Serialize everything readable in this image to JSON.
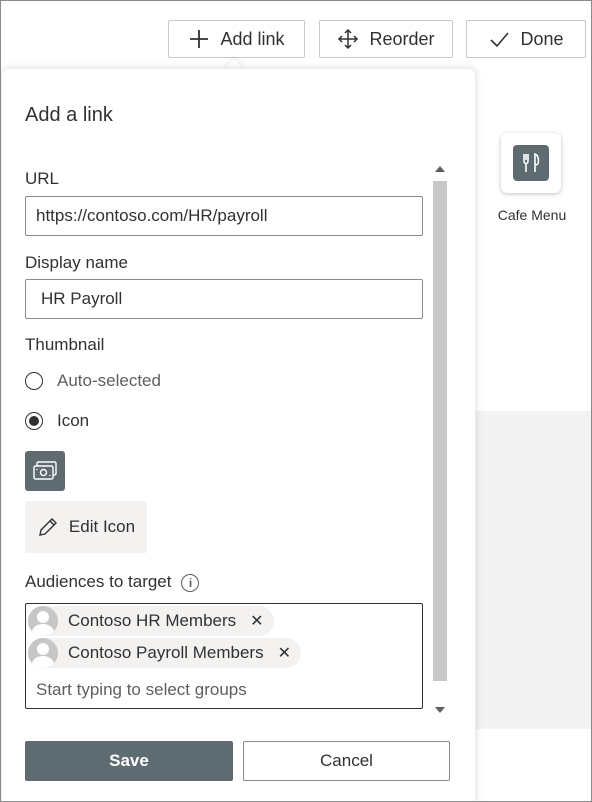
{
  "toolbar": {
    "add_link_label": "Add link",
    "reorder_label": "Reorder",
    "done_label": "Done"
  },
  "tiles": [
    {
      "label": "Cafe Menu",
      "icon": "fork-knife-icon"
    }
  ],
  "panel": {
    "title": "Add a link",
    "url_label": "URL",
    "url_value": "https://contoso.com/HR/payroll",
    "display_name_label": "Display name",
    "display_name_value": "HR Payroll",
    "thumbnail_label": "Thumbnail",
    "thumbnail_options": [
      {
        "label": "Auto-selected",
        "selected": false
      },
      {
        "label": "Icon",
        "selected": true
      }
    ],
    "selected_icon": "money-icon",
    "edit_icon_label": "Edit Icon",
    "audiences_label": "Audiences to target",
    "audiences": [
      {
        "name": "Contoso HR Members"
      },
      {
        "name": "Contoso Payroll Members"
      }
    ],
    "audience_placeholder": "Start typing to select groups",
    "save_label": "Save",
    "cancel_label": "Cancel"
  },
  "colors": {
    "accent": "#5e6b71",
    "text": "#323130",
    "border": "#8a8a8a",
    "chip_bg": "#f3f2f1"
  }
}
